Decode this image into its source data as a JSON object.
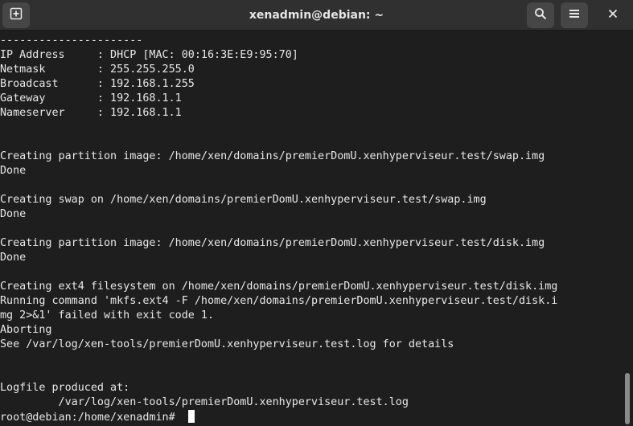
{
  "window": {
    "title": "xenadmin@debian: ~"
  },
  "icons": {
    "new_tab": "new-tab-icon",
    "search": "search-icon",
    "menu": "hamburger-menu-icon",
    "close": "close-icon"
  },
  "colors": {
    "terminal_bg": "#1e1e1e",
    "titlebar_bg": "#303030",
    "text": "#e8e8e8"
  },
  "terminal": {
    "lines": [
      "----------------------",
      "IP Address     : DHCP [MAC: 00:16:3E:E9:95:70]",
      "Netmask        : 255.255.255.0",
      "Broadcast      : 192.168.1.255",
      "Gateway        : 192.168.1.1",
      "Nameserver     : 192.168.1.1",
      "",
      "",
      "Creating partition image: /home/xen/domains/premierDomU.xenhyperviseur.test/swap.img",
      "Done",
      "",
      "Creating swap on /home/xen/domains/premierDomU.xenhyperviseur.test/swap.img",
      "Done",
      "",
      "Creating partition image: /home/xen/domains/premierDomU.xenhyperviseur.test/disk.img",
      "Done",
      "",
      "Creating ext4 filesystem on /home/xen/domains/premierDomU.xenhyperviseur.test/disk.img",
      "Running command 'mkfs.ext4 -F /home/xen/domains/premierDomU.xenhyperviseur.test/disk.i",
      "mg 2>&1' failed with exit code 1.",
      "Aborting",
      "See /var/log/xen-tools/premierDomU.xenhyperviseur.test.log for details",
      "",
      "",
      "Logfile produced at:",
      "         /var/log/xen-tools/premierDomU.xenhyperviseur.test.log"
    ],
    "prompt": "root@debian:/home/xenadmin#"
  }
}
